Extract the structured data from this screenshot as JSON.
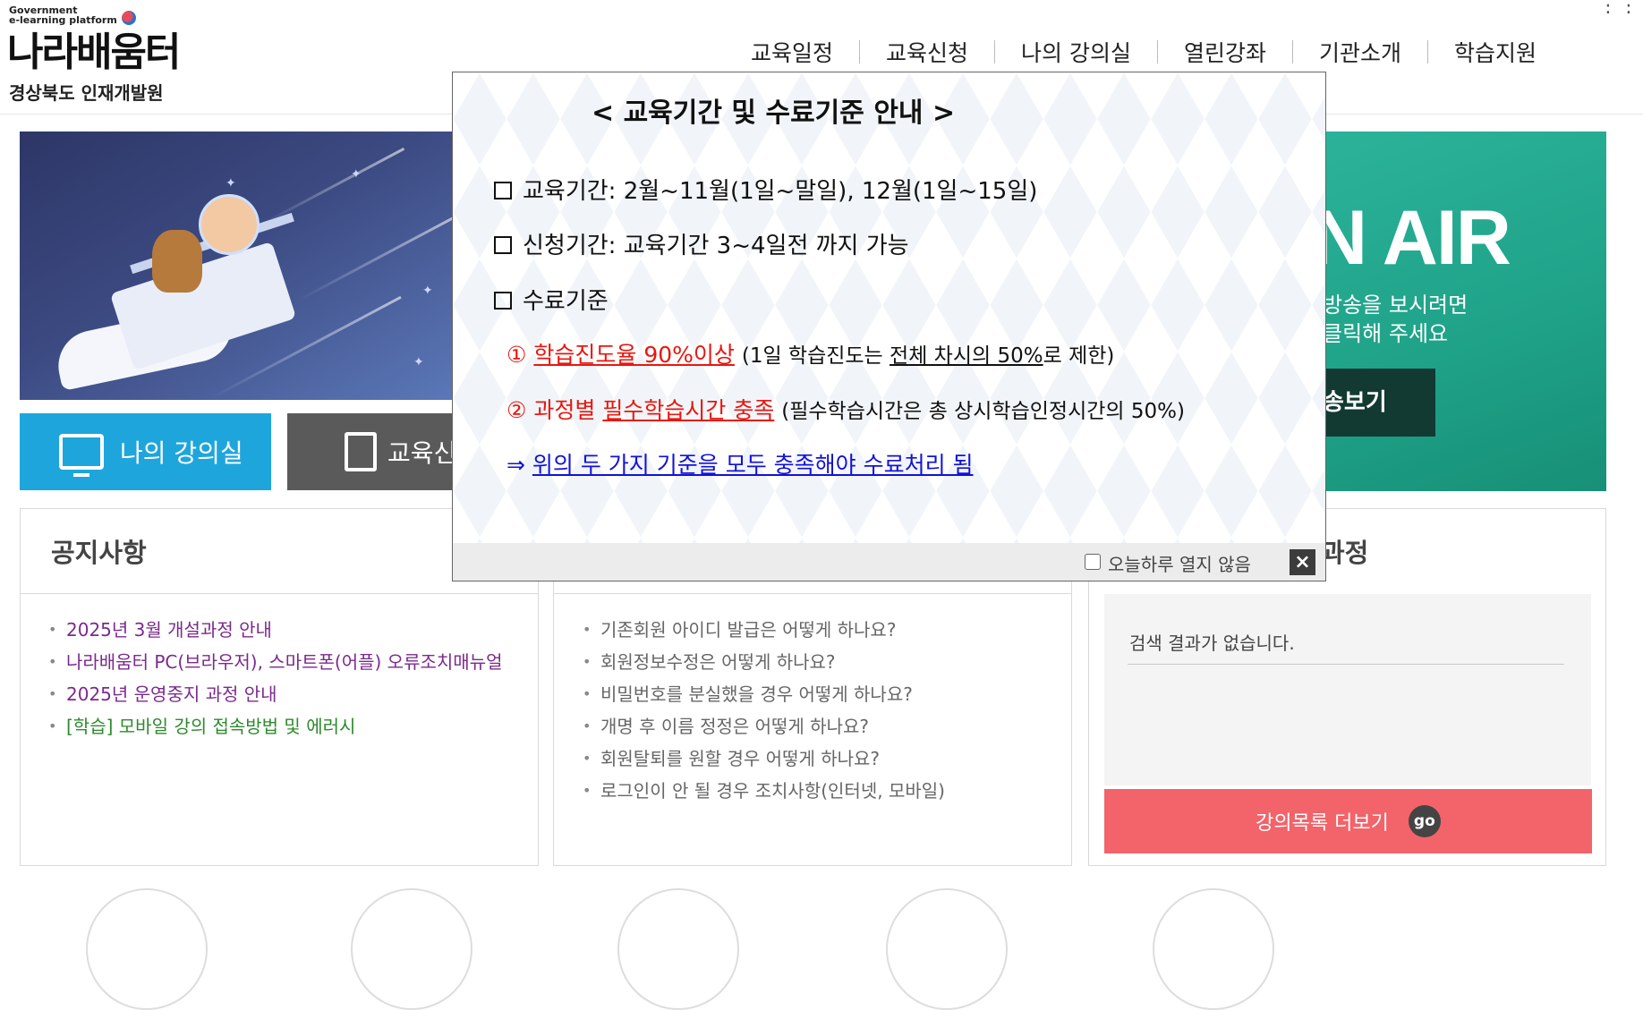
{
  "header": {
    "logo_small": "Government\ne-learning platform",
    "logo_text": "나라배움터",
    "org_name": "경상북도 인재개발원",
    "nav": [
      "교육일정",
      "교육신청",
      "나의 강의실",
      "열린강좌",
      "기관소개",
      "학습지원"
    ],
    "menu_icon": "grid-dots-icon"
  },
  "hero": {
    "onair_title": "N AIR",
    "onair_sub1": "방송을 보시려면",
    "onair_sub2": "클릭해 주세요",
    "onair_button": "송보기",
    "myclass_button": "나의 강의실",
    "apply_button": "교육신"
  },
  "notice": {
    "title": "공지사항",
    "items": [
      "2025년 3월 개설과정 안내",
      "나라배움터 PC(브라우저), 스마트폰(어플) 오류조치매뉴얼",
      "2025년 운영중지 과정 안내",
      "[학습] 모바일 강의 접속방법 및 에러시"
    ]
  },
  "faq": {
    "items": [
      "기존회원 아이디 발급은 어떻게 하나요?",
      "회원정보수정은 어떻게 하나요?",
      "비밀번호를 분실했을 경우 어떻게 하나요?",
      "개명 후 이름 정정은 어떻게 하나요?",
      "회원탈퇴를 원할 경우 어떻게 하나요?",
      "로그인이 안 될 경우 조치사항(인터넷, 모바일)"
    ]
  },
  "course": {
    "title_partial": "과정",
    "empty_text": "검색 결과가 없습니다.",
    "more_button": "강의목록 더보기",
    "go_badge": "go"
  },
  "popup": {
    "title": "< 교육기간 및 수료기준 안내 >",
    "line1": "교육기간:  2월~11월(1일~말일), 12월(1일~15일)",
    "line2": "신청기간: 교육기간 3~4일전 까지 가능",
    "line3": "수료기준",
    "crit1_num": "①",
    "crit1_main": "학습진도율 90%이상",
    "crit1_note_a": "(1일 학습진도는 ",
    "crit1_note_ul": "전체 차시의 50%",
    "crit1_note_b": "로 제한)",
    "crit2_num": "②",
    "crit2_a": "과정별 ",
    "crit2_ul": "필수학습시간 충족",
    "crit2_note": "(필수학습시간은 총 상시학습인정시간의 50%)",
    "crit3_arrow": "⇒",
    "crit3_text": "위의 두 가지 기준을 모두 충족해야 수료처리 됨",
    "footer_checkbox_label": "오늘하루 열지 않음",
    "close_label": "×"
  },
  "colors": {
    "accent_blue": "#1ea6dc",
    "onair_green": "#1ea187",
    "more_button_red": "#f2636a",
    "notice_purple": "#7b2a8c",
    "notice_green": "#2d8a2d",
    "popup_red": "#e8170f",
    "popup_blue": "#1212d8"
  }
}
